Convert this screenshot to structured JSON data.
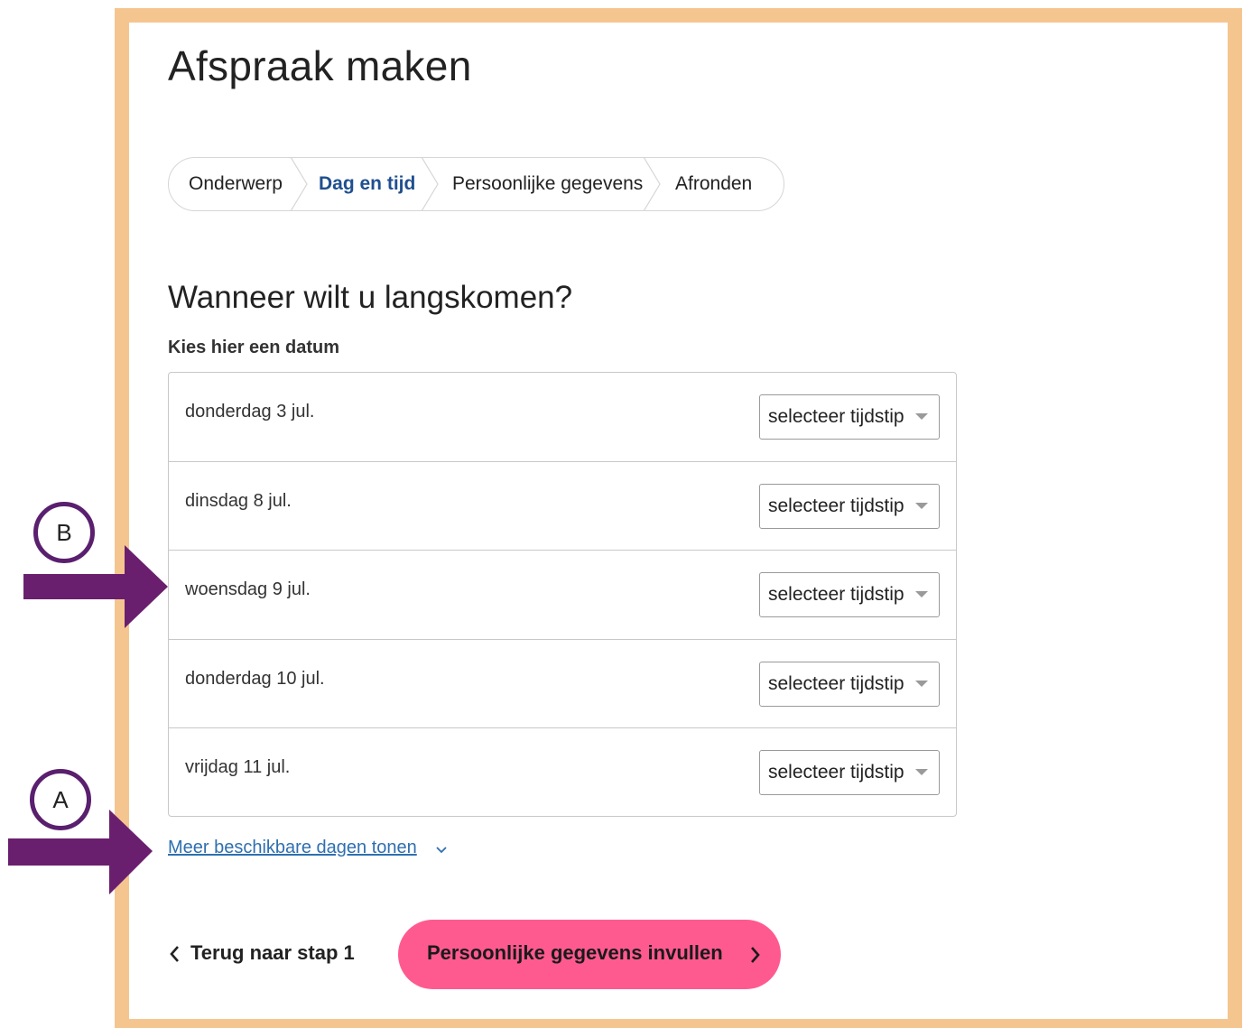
{
  "page": {
    "title": "Afspraak maken"
  },
  "stepper": {
    "steps": [
      {
        "label": "Onderwerp",
        "active": false
      },
      {
        "label": "Dag en tijd",
        "active": true
      },
      {
        "label": "Persoonlijke gegevens",
        "active": false
      },
      {
        "label": "Afronden",
        "active": false
      }
    ]
  },
  "schedule": {
    "heading": "Wanneer wilt u langskomen?",
    "date_label": "Kies hier een datum",
    "dates": [
      {
        "date": "donderdag 3 jul.",
        "select": "selecteer tijdstip"
      },
      {
        "date": "dinsdag 8 jul.",
        "select": "selecteer tijdstip"
      },
      {
        "date": "woensdag 9 jul.",
        "select": "selecteer tijdstip"
      },
      {
        "date": "donderdag 10 jul.",
        "select": "selecteer tijdstip"
      },
      {
        "date": "vrijdag 11 jul.",
        "select": "selecteer tijdstip"
      }
    ],
    "more_link": "Meer beschikbare dagen tonen"
  },
  "footer": {
    "back_label": "Terug naar stap 1",
    "next_label": "Persoonlijke gegevens invullen"
  },
  "annotations": {
    "badge_a": "A",
    "badge_b": "B",
    "arrow_color": "#6a1f6e"
  },
  "colors": {
    "frame": "#f5c590",
    "active_step": "#1f4f8f",
    "link": "#2f6fb0",
    "primary_button": "#ff5a90"
  }
}
